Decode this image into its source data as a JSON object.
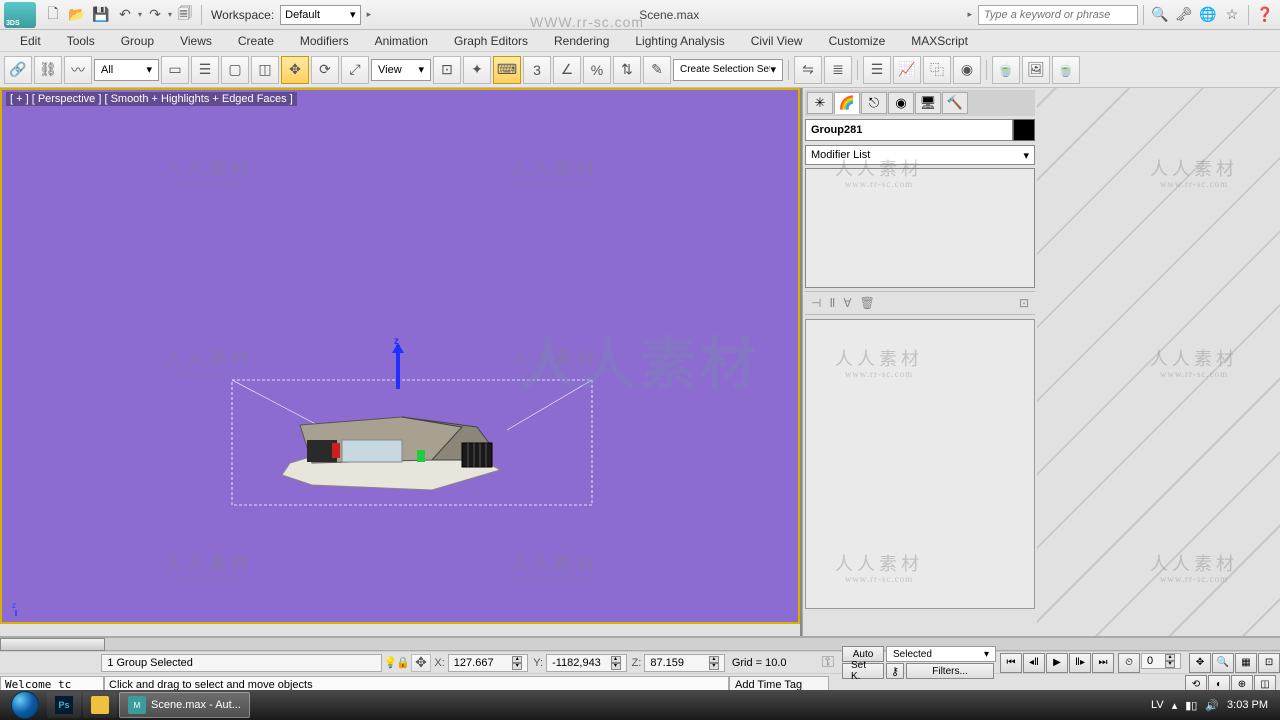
{
  "app": {
    "title": "Scene.max",
    "workspace_label": "Workspace:",
    "workspace_value": "Default",
    "app_badge": "3DS"
  },
  "search": {
    "placeholder": "Type a keyword or phrase"
  },
  "menus": [
    "Edit",
    "Tools",
    "Group",
    "Views",
    "Create",
    "Modifiers",
    "Animation",
    "Graph Editors",
    "Rendering",
    "Lighting Analysis",
    "Civil View",
    "Customize",
    "MAXScript"
  ],
  "toolbar": {
    "sel_filter": "All",
    "ref_coord": "View",
    "named_sel": "Create Selection Set",
    "snap_num": "3"
  },
  "viewport": {
    "label": "[ + ] [ Perspective ] [ Smooth + Highlights + Edged Faces ]"
  },
  "cmd_panel": {
    "object_name": "Group281",
    "modifier_list": "Modifier List"
  },
  "status": {
    "selection": "1 Group Selected",
    "x": "127.667",
    "y": "-1182,943",
    "z": "87.159",
    "grid": "Grid = 10.0",
    "auto": "Auto",
    "setk": "Set K.",
    "sel_combo": "Selected",
    "filters": "Filters...",
    "frame": "0",
    "add_tag": "Add Time Tag",
    "prompt_welcome": "Welcome tc",
    "prompt_hint": "Click and drag to select and move objects"
  },
  "taskbar": {
    "task1": "Scene.max - Aut...",
    "lang": "LV",
    "time": "3:03 PM"
  },
  "watermark": {
    "zh": "人人素材",
    "url": "www.rr-sc.com",
    "big": "人人素材"
  }
}
